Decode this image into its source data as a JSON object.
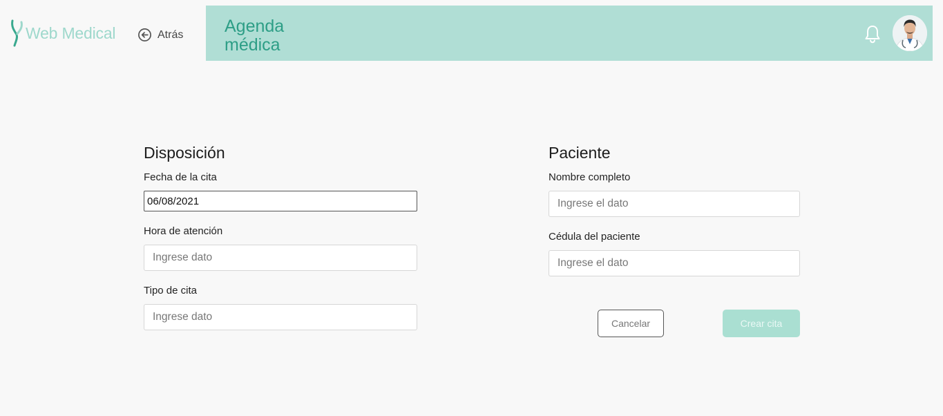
{
  "brand": {
    "name": "Web Medical"
  },
  "nav": {
    "back_label": "Atrás"
  },
  "header": {
    "title": "Agenda médica"
  },
  "icons": {
    "bell": "bell-icon",
    "avatar": "doctor-avatar",
    "back": "arrow-left-circle-icon",
    "logo": "leaf-logo-icon"
  },
  "colors": {
    "header_bg": "#b0ded5",
    "accent": "#2d9e86",
    "brand": "#9ed8cc",
    "primary_button": "#aadfd2"
  },
  "disposicion": {
    "title": "Disposición",
    "fecha_label": "Fecha de la cita",
    "fecha_value": "06/08/2021",
    "hora_label": "Hora de atención",
    "hora_placeholder": "Ingrese dato",
    "tipo_label": "Tipo de cita",
    "tipo_placeholder": "Ingrese dato"
  },
  "paciente": {
    "title": "Paciente",
    "nombre_label": "Nombre completo",
    "nombre_placeholder": "Ingrese el dato",
    "cedula_label": "Cédula del paciente",
    "cedula_placeholder": "Ingrese el dato"
  },
  "actions": {
    "cancel_label": "Cancelar",
    "create_label": "Crear cita"
  }
}
